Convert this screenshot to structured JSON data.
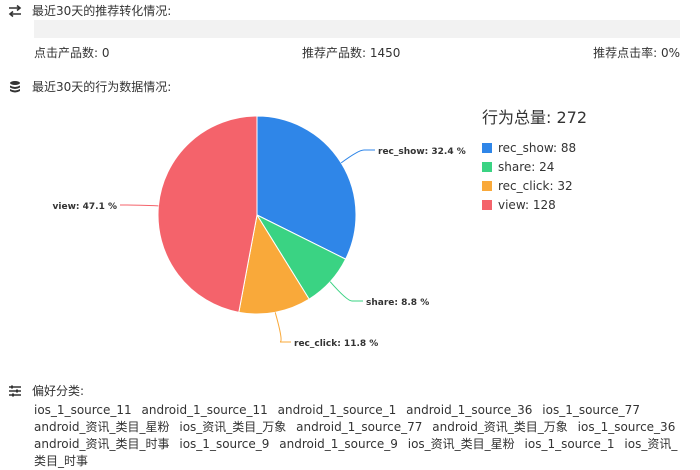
{
  "conversion": {
    "title": "最近30天的推荐转化情况:",
    "stats": [
      {
        "label": "点击产品数",
        "value": "0"
      },
      {
        "label": "推荐产品数",
        "value": "1450"
      },
      {
        "label": "推荐点击率",
        "value": "0%"
      }
    ]
  },
  "behavior": {
    "title": "最近30天的行为数据情况:"
  },
  "chart_data": {
    "type": "pie",
    "legend_title": "行为总量: 272",
    "legend_position": "right",
    "series": [
      {
        "name": "rec_show",
        "value": 88,
        "percent_label": "rec_show: 32.4 %",
        "color": "#2f86e8"
      },
      {
        "name": "share",
        "value": 24,
        "percent_label": "share: 8.8 %",
        "color": "#3ad383"
      },
      {
        "name": "rec_click",
        "value": 32,
        "percent_label": "rec_click: 11.8 %",
        "color": "#f9a93a"
      },
      {
        "name": "view",
        "value": 128,
        "percent_label": "view: 47.1 %",
        "color": "#f4636b"
      }
    ]
  },
  "preferences": {
    "title": "偏好分类:",
    "items": [
      "ios_1_source_11",
      "android_1_source_11",
      "android_1_source_1",
      "android_1_source_36",
      "ios_1_source_77",
      "android_资讯_类目_星粉",
      "ios_资讯_类目_万象",
      "android_1_source_77",
      "android_资讯_类目_万象",
      "ios_1_source_36",
      "android_资讯_类目_时事",
      "ios_1_source_9",
      "android_1_source_9",
      "ios_资讯_类目_星粉",
      "ios_1_source_1",
      "ios_资讯_类目_时事"
    ]
  },
  "icons": {
    "conversion": "swap-arrows-icon",
    "behavior": "database-icon",
    "preferences": "sliders-icon"
  }
}
